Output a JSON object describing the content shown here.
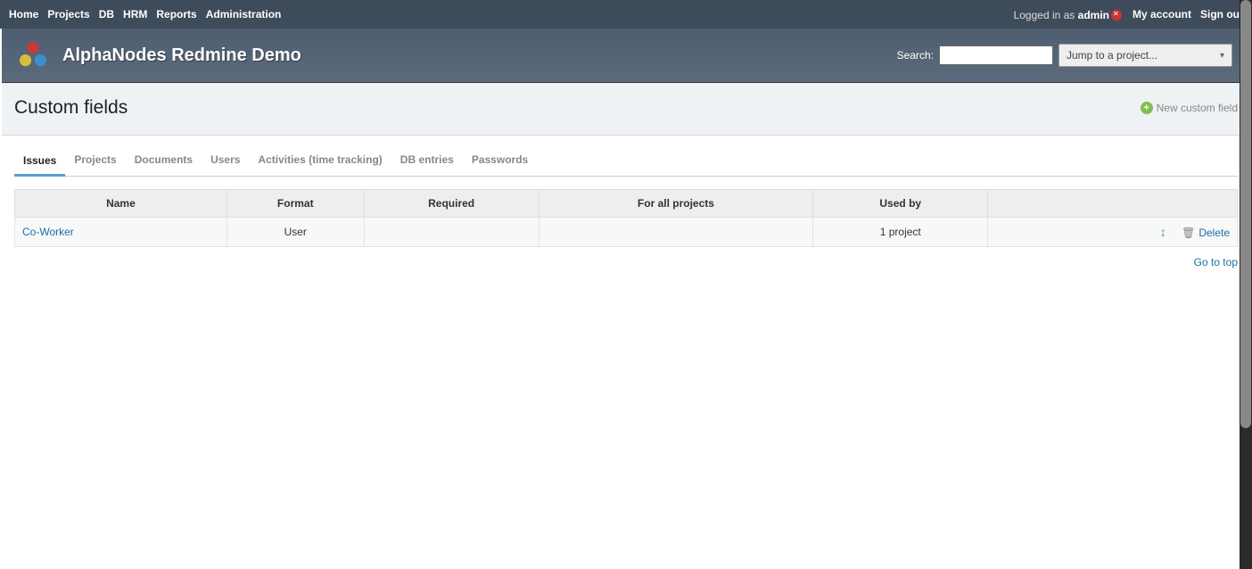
{
  "topmenu": {
    "left": [
      "Home",
      "Projects",
      "DB",
      "HRM",
      "Reports",
      "Administration"
    ],
    "logged_prefix": "Logged in as ",
    "logged_user": "admin",
    "right": [
      "My account",
      "Sign out"
    ]
  },
  "header": {
    "title": "AlphaNodes Redmine Demo",
    "search_label": "Search:",
    "project_jump": "Jump to a project..."
  },
  "page": {
    "title": "Custom fields",
    "new_link": "New custom field",
    "go_top": "Go to top"
  },
  "tabs": [
    "Issues",
    "Projects",
    "Documents",
    "Users",
    "Activities (time tracking)",
    "DB entries",
    "Passwords"
  ],
  "table": {
    "headers": {
      "name": "Name",
      "format": "Format",
      "required": "Required",
      "forall": "For all projects",
      "usedby": "Used by"
    },
    "rows": [
      {
        "name": "Co-Worker",
        "format": "User",
        "required": "",
        "forall": "",
        "usedby": "1 project",
        "delete": "Delete"
      }
    ]
  }
}
